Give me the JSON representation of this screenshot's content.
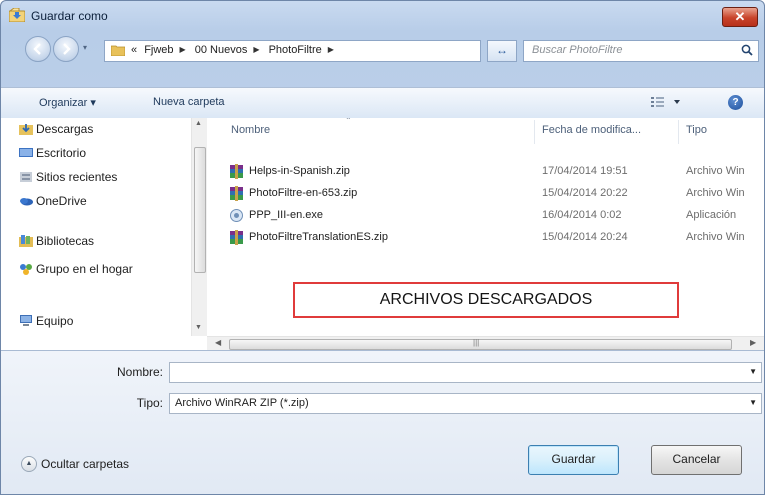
{
  "window": {
    "title": "Guardar como",
    "close_label": "✕"
  },
  "nav": {
    "address": {
      "overflow": "«",
      "crumbs": [
        "Fjweb",
        "00 Nuevos",
        "PhotoFiltre"
      ]
    },
    "search_placeholder": "Buscar PhotoFiltre"
  },
  "toolbar": {
    "organize": "Organizar ▾",
    "new_folder": "Nueva carpeta"
  },
  "sidebar": {
    "items": [
      {
        "label": "Descargas",
        "icon": "downloads-icon"
      },
      {
        "label": "Escritorio",
        "icon": "desktop-icon"
      },
      {
        "label": "Sitios recientes",
        "icon": "recent-places-icon"
      },
      {
        "label": "OneDrive",
        "icon": "onedrive-icon"
      },
      {
        "label": "Bibliotecas",
        "icon": "libraries-icon"
      },
      {
        "label": "Grupo en el hogar",
        "icon": "homegroup-icon"
      },
      {
        "label": "Equipo",
        "icon": "computer-icon"
      }
    ]
  },
  "files": {
    "columns": {
      "name": "Nombre",
      "date": "Fecha de modifica...",
      "type": "Tipo"
    },
    "rows": [
      {
        "name": "Helps-in-Spanish.zip",
        "date": "17/04/2014 19:51",
        "type": "Archivo Win",
        "icon": "winrar-archive-icon"
      },
      {
        "name": "PhotoFiltre-en-653.zip",
        "date": "15/04/2014 20:22",
        "type": "Archivo Win",
        "icon": "winrar-archive-icon"
      },
      {
        "name": "PPP_III-en.exe",
        "date": "16/04/2014 0:02",
        "type": "Aplicación",
        "icon": "exe-setup-icon"
      },
      {
        "name": "PhotoFiltreTranslationES.zip",
        "date": "15/04/2014 20:24",
        "type": "Archivo Win",
        "icon": "winrar-archive-icon"
      }
    ]
  },
  "annotation": "ARCHIVOS DESCARGADOS",
  "form": {
    "filename_label": "Nombre:",
    "filename_value": "",
    "type_label": "Tipo:",
    "type_value": "Archivo WinRAR ZIP (*.zip)"
  },
  "footer": {
    "hide_folders": "Ocultar carpetas",
    "save": "Guardar",
    "cancel": "Cancelar"
  },
  "colors": {
    "titlebar": "#c9daf0",
    "close": "#c8432a",
    "highlight_border": "#e03b3b"
  }
}
